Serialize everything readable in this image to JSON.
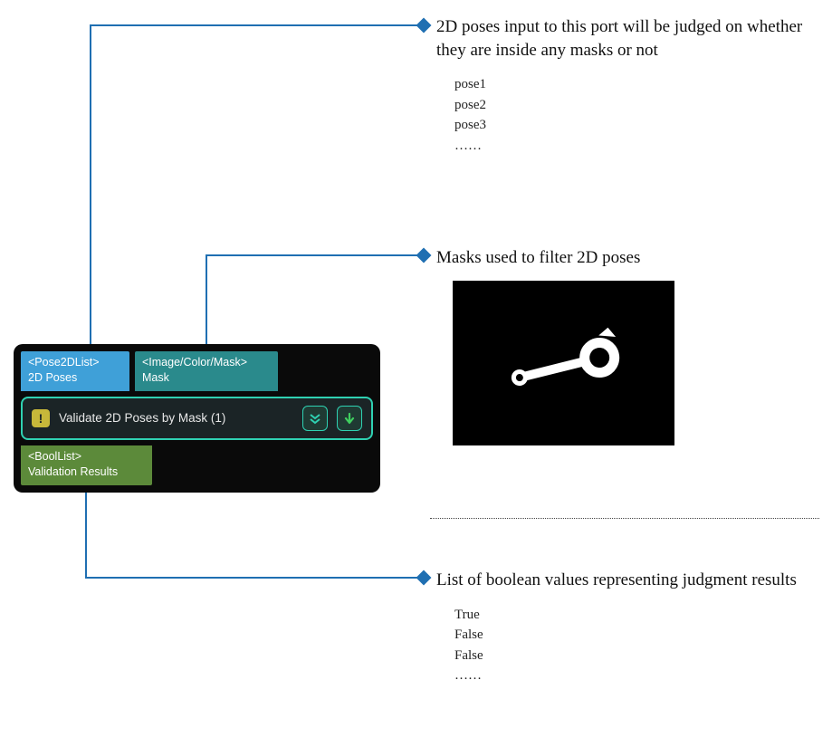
{
  "colors": {
    "connector": "#1f6fb2",
    "node_bg": "#0a0a0a",
    "port_pose": "#3fa0d8",
    "port_mask": "#2a8a8c",
    "port_out": "#5c8a3a",
    "body_border": "#2fd1b2",
    "warn_badge": "#c7b83a"
  },
  "node": {
    "ports_in": [
      {
        "type": "<Pose2DList>",
        "name": "2D Poses"
      },
      {
        "type": "<Image/Color/Mask>",
        "name": "Mask"
      }
    ],
    "title": "Validate 2D Poses by Mask (1)",
    "warn_glyph": "!",
    "ports_out": [
      {
        "type": "<BoolList>",
        "name": "Validation Results"
      }
    ]
  },
  "annotations": {
    "poses": {
      "headline": "2D poses input to this port will be judged on whether they are inside any masks or not",
      "items": [
        "pose1",
        "pose2",
        "pose3",
        "……"
      ]
    },
    "mask": {
      "headline": "Masks used to filter 2D poses"
    },
    "results": {
      "headline": "List of boolean values representing judgment results",
      "items": [
        "True",
        "False",
        "False",
        "……"
      ]
    }
  }
}
